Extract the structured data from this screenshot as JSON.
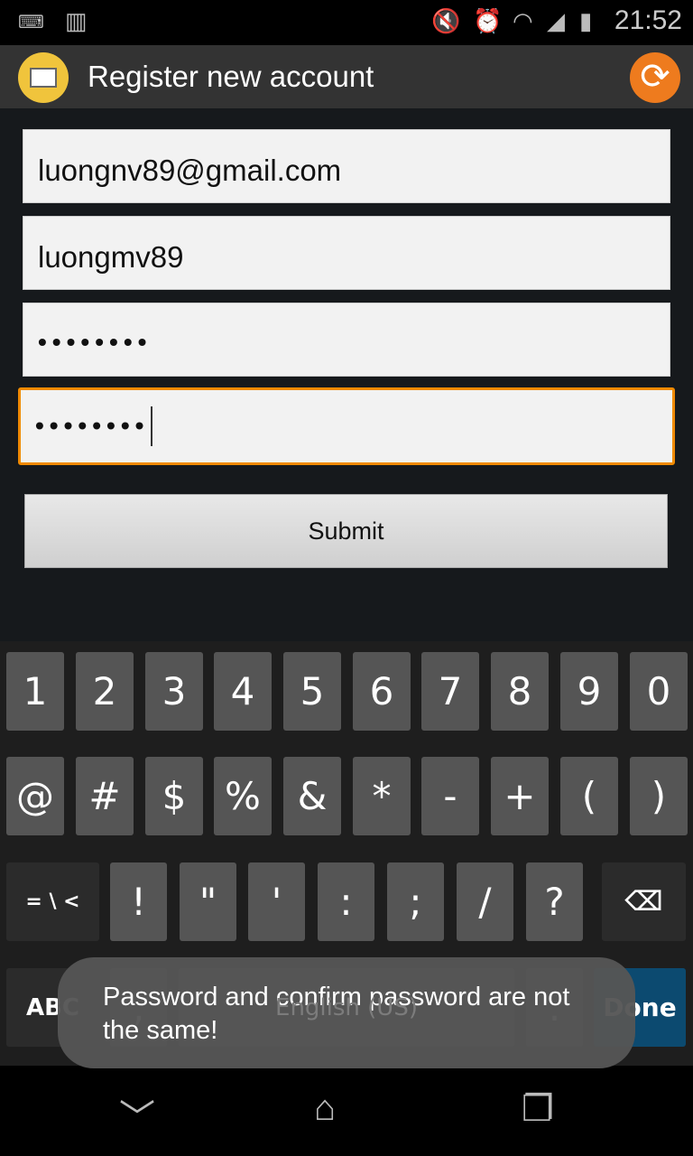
{
  "status_bar": {
    "time": "21:52",
    "icons": [
      "keyboard-icon",
      "barcode-icon",
      "mute-icon",
      "alarm-icon",
      "wifi-icon",
      "signal-icon",
      "battery-charging-icon"
    ]
  },
  "action_bar": {
    "title": "Register new account",
    "logo_icon": "presentation-chart-icon",
    "refresh_icon": "refresh-icon"
  },
  "form": {
    "email": "luongnv89@gmail.com",
    "username": "luongmv89",
    "password": "••••••••",
    "confirm_password": "••••••••",
    "submit_label": "Submit"
  },
  "keyboard": {
    "row1": [
      "1",
      "2",
      "3",
      "4",
      "5",
      "6",
      "7",
      "8",
      "9",
      "0"
    ],
    "row2": [
      "@",
      "#",
      "$",
      "%",
      "&",
      "*",
      "-",
      "+",
      "(",
      ")"
    ],
    "row3_special": "= \\ <",
    "row3": [
      "!",
      "\"",
      "'",
      ":",
      ";",
      "/",
      "?"
    ],
    "abc": "ABC",
    "comma": ",",
    "space": "English (US)",
    "period": ".",
    "done": "Done",
    "accent": "#0c4a70"
  },
  "toast": {
    "message": "Password and confirm password are not the same!"
  },
  "nav_bar": {
    "icons": [
      "back-icon",
      "home-icon",
      "recents-icon"
    ]
  }
}
